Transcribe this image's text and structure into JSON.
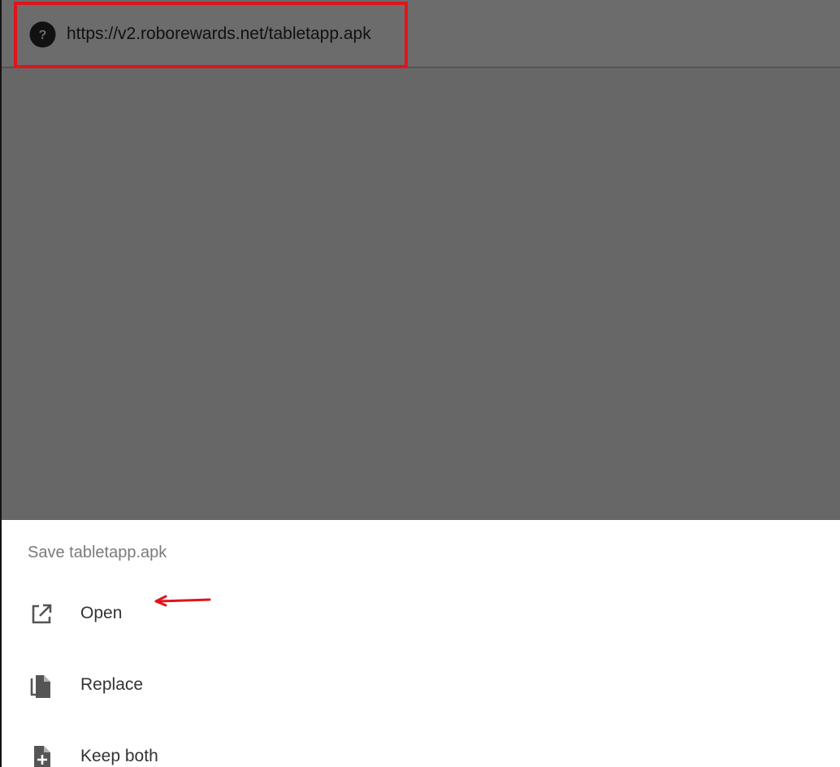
{
  "address_bar": {
    "url": "https://v2.roborewards.net/tabletapp.apk",
    "site_icon": "question-mark-circle-icon"
  },
  "download_sheet": {
    "title": "Save tabletapp.apk",
    "options": [
      {
        "label": "Open",
        "icon": "open-in-new-icon"
      },
      {
        "label": "Replace",
        "icon": "copy-file-icon"
      },
      {
        "label": "Keep both",
        "icon": "add-file-icon"
      }
    ]
  },
  "annotations": {
    "highlight_color": "#e1141b",
    "arrow_color": "#e1141b"
  },
  "colors": {
    "overlay": "#676767",
    "sheet_background": "#ffffff",
    "icon": "#555555"
  }
}
